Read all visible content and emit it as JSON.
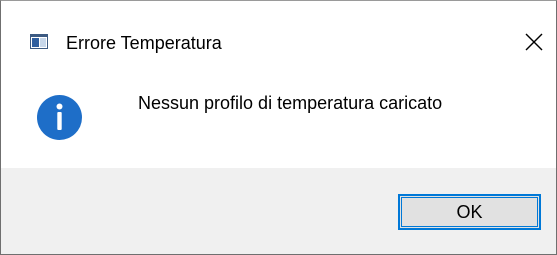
{
  "window": {
    "title": "Errore Temperatura",
    "app_icon": "window-app-icon",
    "close_icon": "close-icon",
    "close_glyph": "✕"
  },
  "message": {
    "icon": "info-icon",
    "icon_color": "#1e6ec8",
    "text": "Nessun profilo di temperatura caricato"
  },
  "footer": {
    "ok_label": "OK",
    "accent_color": "#0078d7"
  }
}
